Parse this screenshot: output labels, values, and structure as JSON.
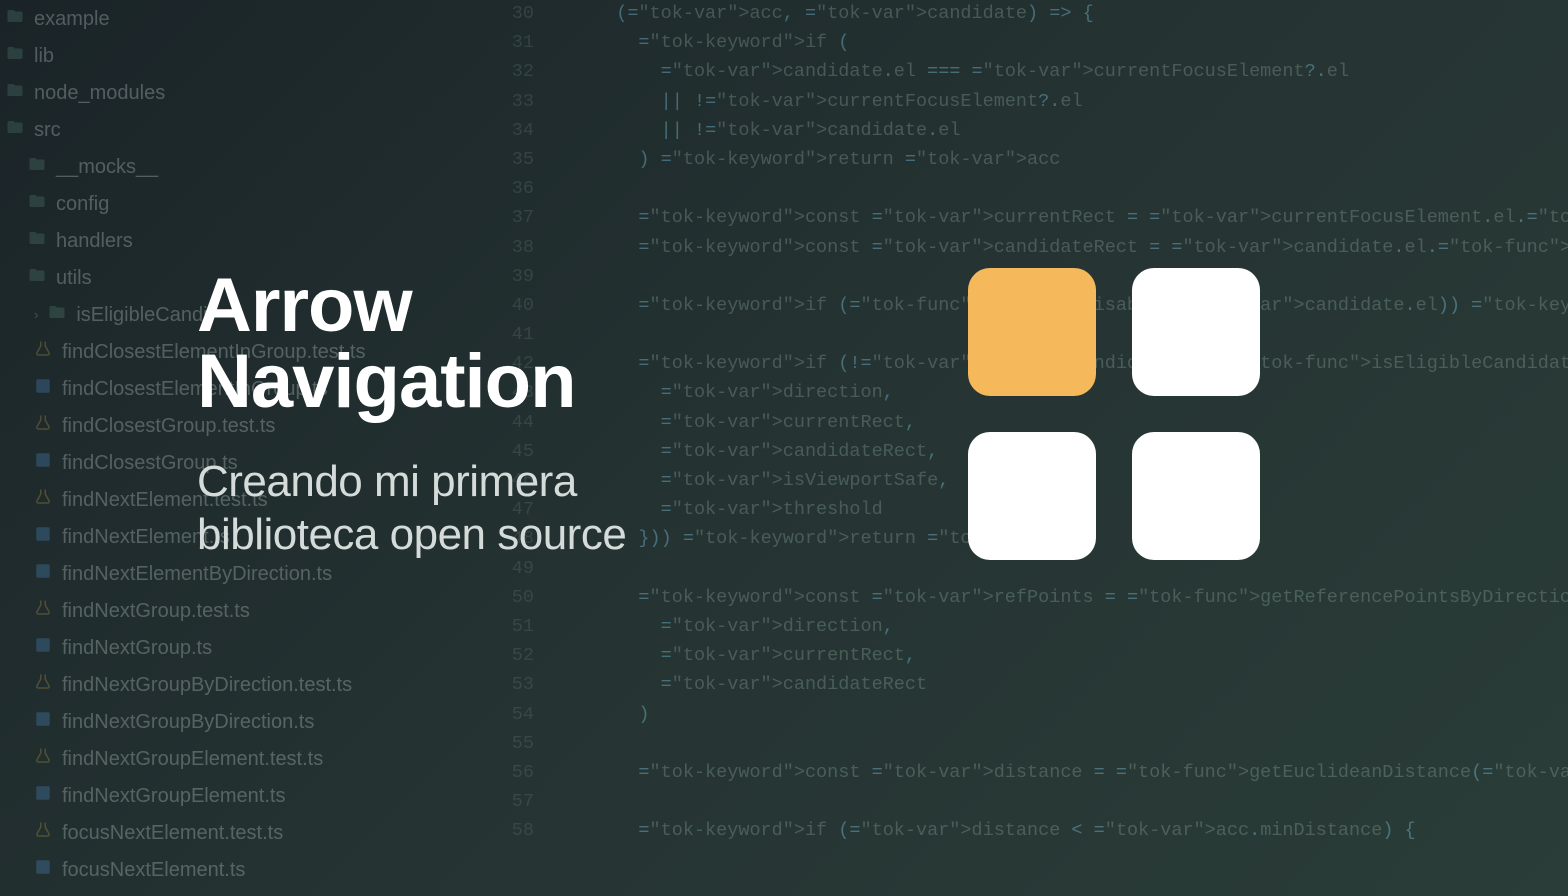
{
  "overlay": {
    "title_line1": "Arrow",
    "title_line2": "Navigation",
    "subtitle_line1": "Creando mi primera",
    "subtitle_line2": "biblioteca open source"
  },
  "logo": {
    "accent": "#f5b85a",
    "neutral": "#ffffff"
  },
  "sidebar": {
    "items": [
      {
        "label": "example",
        "icon": "folder",
        "indent": 0
      },
      {
        "label": "lib",
        "icon": "folder",
        "indent": 0
      },
      {
        "label": "node_modules",
        "icon": "folder",
        "indent": 0
      },
      {
        "label": "src",
        "icon": "folder",
        "indent": 0
      },
      {
        "label": "__mocks__",
        "icon": "folder",
        "indent": 1
      },
      {
        "label": "config",
        "icon": "folder",
        "indent": 1
      },
      {
        "label": "handlers",
        "icon": "folder",
        "indent": 1
      },
      {
        "label": "utils",
        "icon": "folder",
        "indent": 1
      },
      {
        "label": "isEligibleCandi",
        "icon": "folder",
        "indent": 2,
        "caret": true
      },
      {
        "label": "findClosestElementInGroup.test.ts",
        "icon": "test",
        "indent": 2
      },
      {
        "label": "findClosestElementInGroup.ts",
        "icon": "ts",
        "indent": 2
      },
      {
        "label": "findClosestGroup.test.ts",
        "icon": "test",
        "indent": 2
      },
      {
        "label": "findClosestGroup.ts",
        "icon": "ts",
        "indent": 2
      },
      {
        "label": "findNextElement.test.ts",
        "icon": "test",
        "indent": 2
      },
      {
        "label": "findNextElement.ts",
        "icon": "ts",
        "indent": 2
      },
      {
        "label": "findNextElementByDirection.ts",
        "icon": "ts",
        "indent": 2
      },
      {
        "label": "findNextGroup.test.ts",
        "icon": "test",
        "indent": 2
      },
      {
        "label": "findNextGroup.ts",
        "icon": "ts",
        "indent": 2
      },
      {
        "label": "findNextGroupByDirection.test.ts",
        "icon": "test",
        "indent": 2
      },
      {
        "label": "findNextGroupByDirection.ts",
        "icon": "ts",
        "indent": 2
      },
      {
        "label": "findNextGroupElement.test.ts",
        "icon": "test",
        "indent": 2
      },
      {
        "label": "findNextGroupElement.ts",
        "icon": "ts",
        "indent": 2
      },
      {
        "label": "focusNextElement.test.ts",
        "icon": "test",
        "indent": 2
      },
      {
        "label": "focusNextElement.ts",
        "icon": "ts",
        "indent": 2
      }
    ]
  },
  "gutter": {
    "start": 30,
    "end": 58
  },
  "code": {
    "lines": [
      "  (acc, candidate) => {",
      "    if (",
      "      candidate.el === currentFocusElement?.el",
      "      || !currentFocusElement?.el",
      "      || !candidate.el",
      "    ) return acc",
      "",
      "    const currentRect = currentFocusElement.el.getBoundingClientRect()",
      "    const candidateRect = candidate.el.getBoundingClientRect()",
      "",
      "    if (isElementDisabled(candidate.el)) return acc",
      "",
      "    if (!allValidCandidates && !isEligibleCandidate({",
      "      direction,",
      "      currentRect,",
      "      candidateRect,",
      "      isViewportSafe,",
      "      threshold",
      "    })) return acc",
      "",
      "    const refPoints = getReferencePointsByDirection(",
      "      direction,",
      "      currentRect,",
      "      candidateRect",
      "    )",
      "",
      "    const distance = getEuclideanDistance(refPoints.a, refPoints.b)",
      "",
      "    if (distance < acc.minDistance) {"
    ]
  }
}
